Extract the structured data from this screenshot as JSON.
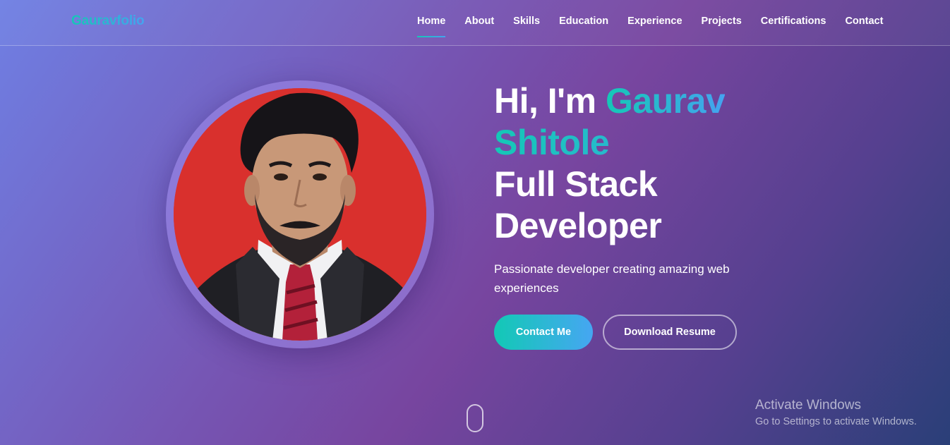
{
  "nav": {
    "logo": "Gauravfolio",
    "links": [
      {
        "label": "Home",
        "active": true
      },
      {
        "label": "About"
      },
      {
        "label": "Skills"
      },
      {
        "label": "Education"
      },
      {
        "label": "Experience"
      },
      {
        "label": "Projects"
      },
      {
        "label": "Certifications"
      },
      {
        "label": "Contact"
      }
    ]
  },
  "hero": {
    "greeting": "Hi, I'm",
    "first_name": "Gaurav",
    "last_name": "Shitole",
    "role_line1": "Full Stack",
    "role_line2": "Developer",
    "tagline": "Passionate developer creating amazing web experiences",
    "primary_button": "Contact Me",
    "secondary_button": "Download Resume"
  },
  "watermark": {
    "title": "Activate Windows",
    "subtitle": "Go to Settings to activate Windows."
  },
  "colors": {
    "accent_start": "#14c8b6",
    "accent_end": "#45a3f0",
    "avatar_background": "#d9302d"
  }
}
